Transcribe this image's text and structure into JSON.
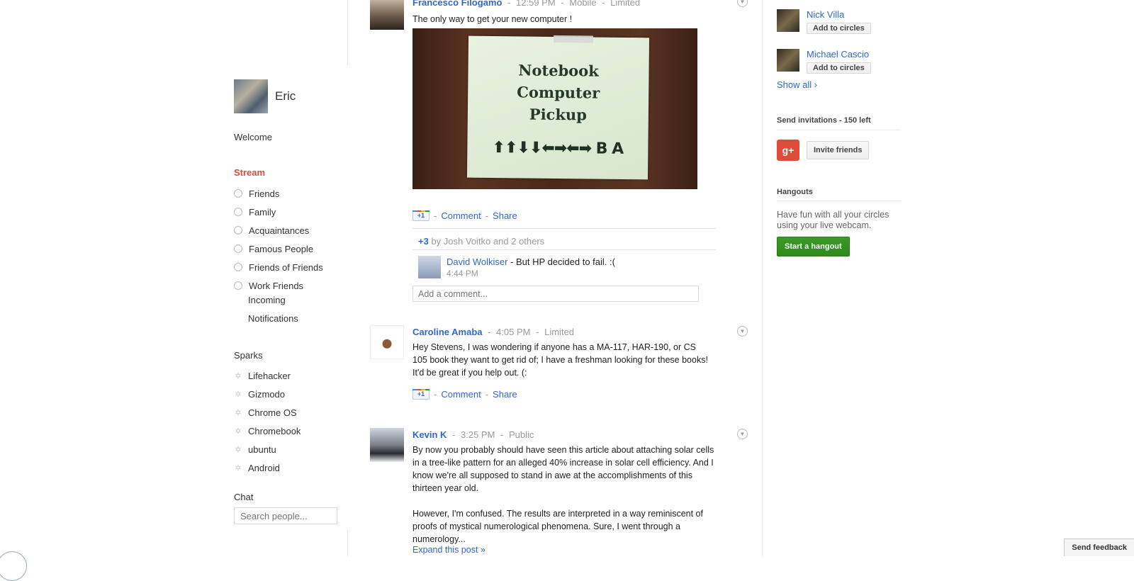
{
  "left_nav": {
    "profile_name": "Eric",
    "welcome": "Welcome",
    "stream": "Stream",
    "circles": [
      "Friends",
      "Family",
      "Acquaintances",
      "Famous People",
      "Friends of Friends",
      "Work Friends"
    ],
    "extra": [
      "Incoming",
      "Notifications"
    ],
    "sparks_title": "Sparks",
    "sparks": [
      "Lifehacker",
      "Gizmodo",
      "Chrome OS",
      "Chromebook",
      "ubuntu",
      "Android"
    ],
    "chat_title": "Chat",
    "chat_placeholder": "Search people..."
  },
  "posts": [
    {
      "author": "Francesco Filogamo",
      "time": "12:59 PM",
      "source": "Mobile",
      "visibility": "Limited",
      "text": "The only way to get your new computer !",
      "photo_sign": [
        "Notebook",
        "Computer",
        "Pickup"
      ],
      "photo_arrows": "⬆⬆⬇⬇⬅➡⬅➡ B A",
      "comment_label": "Comment",
      "share_label": "Share",
      "plus_one": "+1",
      "plus_count": "+3",
      "plus_by": "by Josh Voitko and 2 others",
      "comment_author": "David Wolkiser",
      "comment_text": " - But HP decided to fail. :(",
      "comment_time": "4:44 PM",
      "add_comment_placeholder": "Add a comment..."
    },
    {
      "author": "Caroline Amaba",
      "time": "4:05 PM",
      "visibility": "Limited",
      "text": "Hey Stevens, I was wondering if anyone has a MA-117, HAR-190, or CS 105 book they want to get rid of; I have a freshman looking for these books! It'd be great if you help out. (:",
      "comment_label": "Comment",
      "share_label": "Share",
      "plus_one": "+1"
    },
    {
      "author": "Kevin K",
      "time": "3:25 PM",
      "visibility": "Public",
      "text_p1": "By now you probably should have seen this article about attaching solar cells in a tree-like pattern for an alleged 40% increase in solar cell efficiency. And I know we're all supposed to stand in awe at the accomplishments of this thirteen year old.",
      "text_p2": "However, I'm confused. The results are interpreted in a way reminiscent of proofs of mystical numerological phenomena. Sure, I went through a numerology...",
      "expand": "Expand this post »"
    }
  ],
  "right": {
    "suggestions": [
      {
        "name": "Nick Villa",
        "button": "Add to circles"
      },
      {
        "name": "Michael Cascio",
        "button": "Add to circles"
      }
    ],
    "show_all": "Show all ›",
    "invitations_title": "Send invitations - 150 left",
    "invite_button": "Invite friends",
    "gplus_icon_text": "g+",
    "hangouts_title": "Hangouts",
    "hangouts_desc": "Have fun with all your circles using your live webcam.",
    "hangout_button": "Start a hangout"
  },
  "feedback": "Send feedback",
  "separator": "-"
}
